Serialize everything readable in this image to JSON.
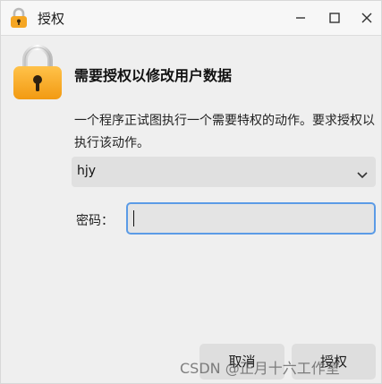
{
  "window": {
    "title": "授权"
  },
  "header": {
    "heading": "需要授权以修改用户数据"
  },
  "body": {
    "description": "一个程序正试图执行一个需要特权的动作。要求授权以执行该动作。"
  },
  "user_select": {
    "selected": "hjy"
  },
  "password": {
    "label": "密码：",
    "value": ""
  },
  "buttons": {
    "cancel": "取消",
    "ok": "授权"
  },
  "watermark": {
    "text": "CSDN @正月十六工作室"
  },
  "colors": {
    "lock_body": "#f5a623",
    "focus_border": "#5b9be6"
  },
  "icons": {
    "title": "lock-icon",
    "dialog": "lock-icon"
  }
}
